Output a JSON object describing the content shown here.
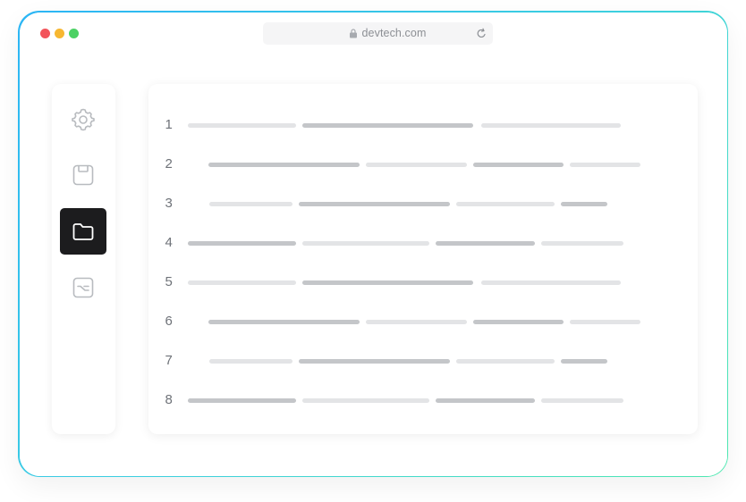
{
  "browser": {
    "url": "devtech.com",
    "traffic_lights": {
      "close": "#f2545b",
      "minimize": "#f7b731",
      "maximize": "#4cd164"
    },
    "icons": {
      "lock": "lock-icon",
      "reload": "reload-icon"
    }
  },
  "sidebar": {
    "items": [
      {
        "name": "settings",
        "icon": "gear-icon",
        "active": false
      },
      {
        "name": "save",
        "icon": "floppy-disk-icon",
        "active": false
      },
      {
        "name": "folder",
        "icon": "folder-icon",
        "active": true
      },
      {
        "name": "terminal",
        "icon": "terminal-icon",
        "active": false
      }
    ]
  },
  "editor": {
    "lines": [
      {
        "number": "1"
      },
      {
        "number": "2"
      },
      {
        "number": "3"
      },
      {
        "number": "4"
      },
      {
        "number": "5"
      },
      {
        "number": "6"
      },
      {
        "number": "7"
      },
      {
        "number": "8"
      }
    ]
  },
  "colors": {
    "frame_gradient_start": "#2bb5f5",
    "frame_gradient_end": "#4ee8b0",
    "active_sidebar_bg": "#1c1c1e",
    "placeholder_light": "#e3e4e6",
    "placeholder_dark": "#c4c6c9"
  }
}
